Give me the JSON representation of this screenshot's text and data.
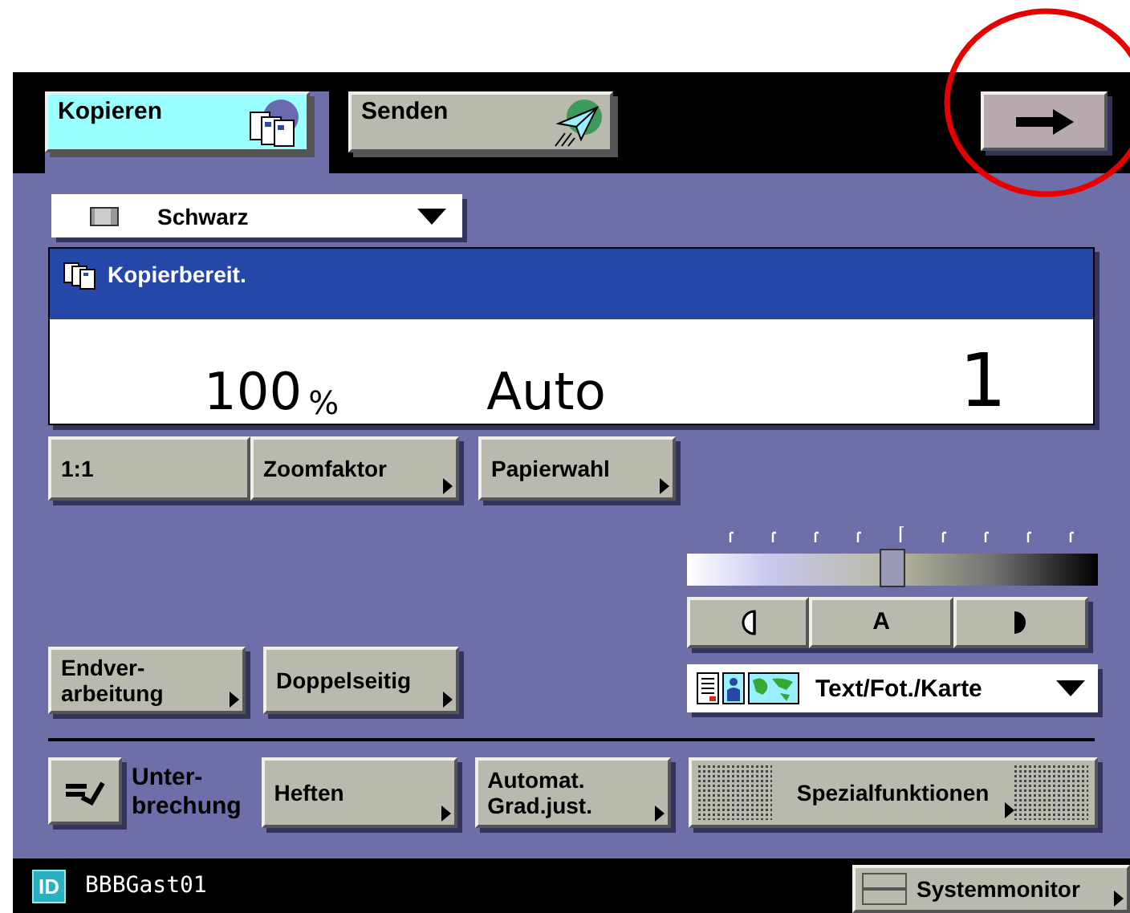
{
  "tabs": [
    {
      "label": "Kopieren",
      "selected": true,
      "kind": "copy"
    },
    {
      "label": "Senden",
      "selected": false,
      "kind": "send"
    }
  ],
  "color_mode": {
    "value": "Schwarz"
  },
  "status": {
    "message": "Kopierbereit.",
    "zoom": "100",
    "zoom_unit": "%",
    "paper": "Auto",
    "copies": "1"
  },
  "copy_buttons": [
    {
      "label": "1:1",
      "submenu": false
    },
    {
      "label": "Zoomfaktor",
      "submenu": true
    },
    {
      "label": "Papierwahl",
      "submenu": true
    }
  ],
  "density": {
    "level": 0.5,
    "buttons": [
      {
        "kind": "lighter"
      },
      {
        "kind": "auto",
        "label": "A"
      },
      {
        "kind": "darker"
      }
    ]
  },
  "function_buttons": [
    {
      "label": "Endver-\narbeitung",
      "submenu": true
    },
    {
      "label": "Doppelseitig",
      "submenu": true
    }
  ],
  "original_type": {
    "value": "Text/Fot./Karte"
  },
  "bottom_buttons": [
    {
      "kind": "interrupt",
      "label": "Unter-\nbrechung"
    },
    {
      "kind": "plain",
      "label": "Heften",
      "submenu": true
    },
    {
      "kind": "plain",
      "label": "Automat.\nGrad.just.",
      "submenu": true
    },
    {
      "kind": "special",
      "label": "Spezialfunktionen",
      "submenu": true
    }
  ],
  "status_bar": {
    "id_badge": "ID",
    "user": "BBBGast01",
    "monitor_button": "Systemmonitor"
  }
}
